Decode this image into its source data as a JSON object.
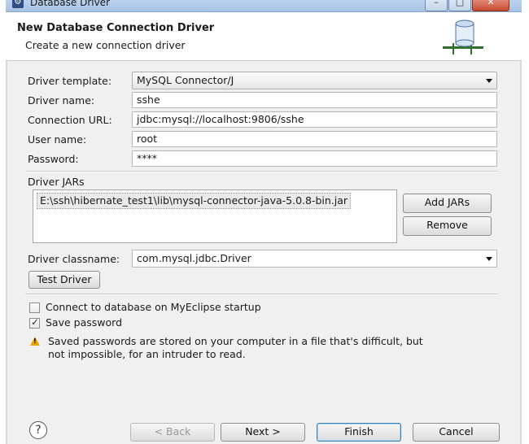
{
  "window": {
    "title": "Database Driver",
    "minimize": "–",
    "maximize": "□",
    "close": "✕"
  },
  "banner": {
    "title": "New Database Connection Driver",
    "subtitle": "Create a new connection driver"
  },
  "form": {
    "driver_template_label": "Driver template:",
    "driver_template_value": "MySQL Connector/J",
    "driver_name_label": "Driver name:",
    "driver_name_value": "sshe",
    "connection_url_label": "Connection URL:",
    "connection_url_value": "jdbc:mysql://localhost:9806/sshe",
    "user_name_label": "User name:",
    "user_name_value": "root",
    "password_label": "Password:",
    "password_value": "****"
  },
  "jars": {
    "label": "Driver JARs",
    "items": [
      "E:\\ssh\\hibernate_test1\\lib\\mysql-connector-java-5.0.8-bin.jar"
    ],
    "add_button": "Add JARs",
    "remove_button": "Remove"
  },
  "classname": {
    "label": "Driver classname:",
    "value": "com.mysql.jdbc.Driver"
  },
  "test_button": "Test Driver",
  "options": {
    "connect_on_startup": {
      "label": "Connect to database on MyEclipse startup",
      "checked": false
    },
    "save_password": {
      "label": "Save password",
      "checked": true
    }
  },
  "warning": {
    "line1": "Saved passwords are stored on your computer in a file that's difficult, but",
    "line2": "not impossible, for an intruder to read."
  },
  "footer": {
    "help": "?",
    "back": "< Back",
    "next": "Next >",
    "finish": "Finish",
    "cancel": "Cancel"
  }
}
